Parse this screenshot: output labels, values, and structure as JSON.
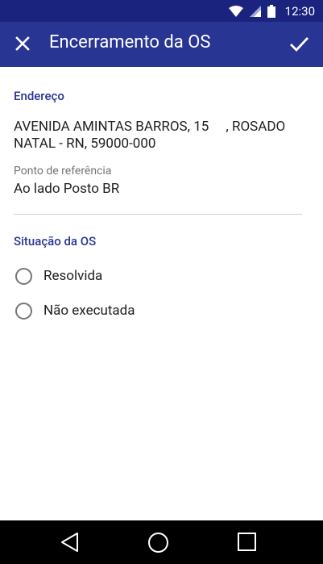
{
  "status_bar": {
    "time": "12:30",
    "background": "#1a237e",
    "icons": [
      "wifi-icon",
      "signal-icon",
      "battery-icon"
    ]
  },
  "app_bar": {
    "title": "Encerramento da OS",
    "background": "#283593",
    "close_icon": "close-icon",
    "confirm_icon": "check-icon"
  },
  "address_section": {
    "title": "Endereço",
    "address_line1": "AVENIDA AMINTAS BARROS, 15     , ROSADO",
    "address_line2": "NATAL - RN, 59000-000",
    "reference_label": "Ponto de referência",
    "reference_value": "Ao lado Posto BR"
  },
  "status_section": {
    "title": "Situação da OS",
    "options": [
      {
        "label": "Resolvida",
        "selected": false
      },
      {
        "label": "Não executada",
        "selected": false
      }
    ]
  },
  "nav_bar": {
    "icons": [
      "back-icon",
      "home-icon",
      "recents-icon"
    ]
  }
}
